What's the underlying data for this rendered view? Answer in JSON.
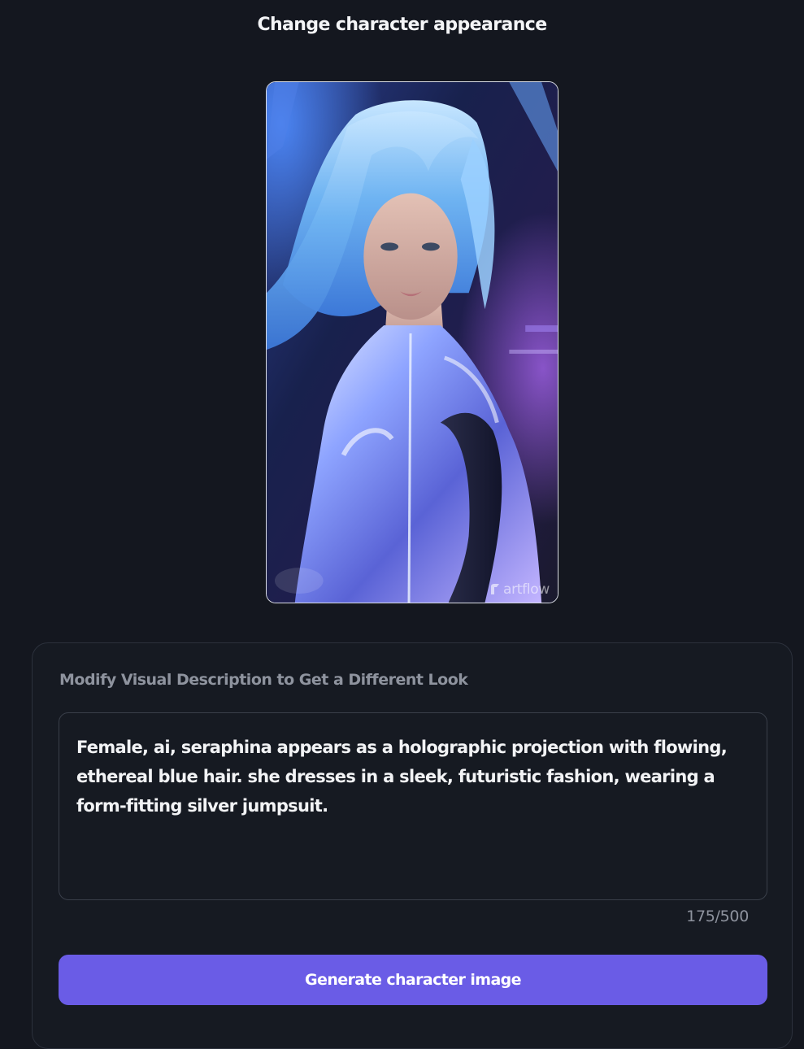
{
  "header": {
    "title": "Change character appearance"
  },
  "portrait": {
    "watermark_text": "artflow",
    "watermark_icon": "artflow-logo-icon",
    "subject": "character portrait"
  },
  "appearance_form": {
    "label": "Modify Visual Description to Get a Different Look",
    "description_value": "Female, ai, seraphina appears as a holographic projection with flowing, ethereal blue hair. she dresses in a sleek, futuristic fashion, wearing a form-fitting silver jumpsuit.",
    "char_count": "175/500",
    "generate_label": "Generate character image"
  },
  "colors": {
    "background": "#14171f",
    "card_background": "#161a22",
    "card_border": "#2c313c",
    "accent": "#6a5ce6",
    "muted_text": "#8e939e"
  }
}
